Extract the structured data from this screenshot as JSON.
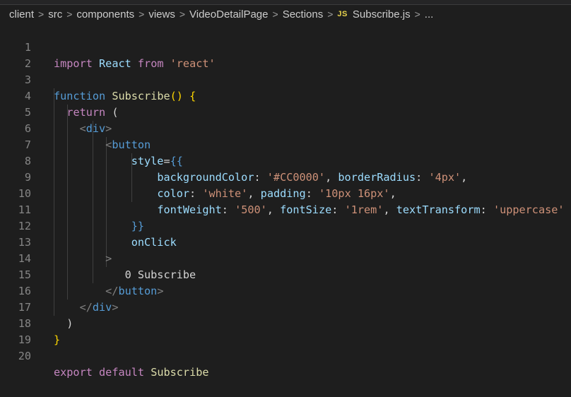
{
  "breadcrumb": {
    "items": [
      "client",
      "src",
      "components",
      "views",
      "VideoDetailPage",
      "Sections"
    ],
    "file_badge": "JS",
    "file_name": "Subscribe.js",
    "ellipsis": "...",
    "separator": ">"
  },
  "line_numbers": [
    "1",
    "2",
    "3",
    "4",
    "5",
    "6",
    "7",
    "8",
    "9",
    "10",
    "11",
    "12",
    "13",
    "14",
    "15",
    "16",
    "17",
    "18",
    "19",
    "20"
  ],
  "code": {
    "l1": {
      "import": "import",
      "react_id": "React",
      "from": "from",
      "module": "'react'"
    },
    "l3": {
      "function": "function",
      "name": "Subscribe",
      "parens": "()",
      "brace": "{"
    },
    "l4": {
      "return": "return",
      "paren": "("
    },
    "l5": {
      "open": "<",
      "tag": "div",
      "close": ">"
    },
    "l6": {
      "open": "<",
      "tag": "button"
    },
    "l7": {
      "attr": "style",
      "eq": "=",
      "brace": "{{"
    },
    "l8": {
      "k1": "backgroundColor",
      "c1": ":",
      "v1": "'#CC0000'",
      "comma1": ",",
      "k2": "borderRadius",
      "c2": ":",
      "v2": "'4px'",
      "comma2": ","
    },
    "l9": {
      "k1": "color",
      "c1": ":",
      "v1": "'white'",
      "comma1": ",",
      "k2": "padding",
      "c2": ":",
      "v2": "'10px 16px'",
      "comma2": ","
    },
    "l10": {
      "k1": "fontWeight",
      "c1": ":",
      "v1": "'500'",
      "comma1": ",",
      "k2": "fontSize",
      "c2": ":",
      "v2": "'1rem'",
      "comma2": ",",
      "k3": "textTransform",
      "c3": ":",
      "v3": "'uppercase'"
    },
    "l11": {
      "brace": "}}"
    },
    "l12": {
      "attr": "onClick"
    },
    "l13": {
      "close": ">"
    },
    "l14": {
      "text": "0 Subscribe"
    },
    "l15": {
      "open": "</",
      "tag": "button",
      "close": ">"
    },
    "l16": {
      "open": "</",
      "tag": "div",
      "close": ">"
    },
    "l17": {
      "paren": ")"
    },
    "l18": {
      "brace": "}"
    },
    "l20": {
      "export": "export",
      "default": "default",
      "name": "Subscribe"
    }
  }
}
